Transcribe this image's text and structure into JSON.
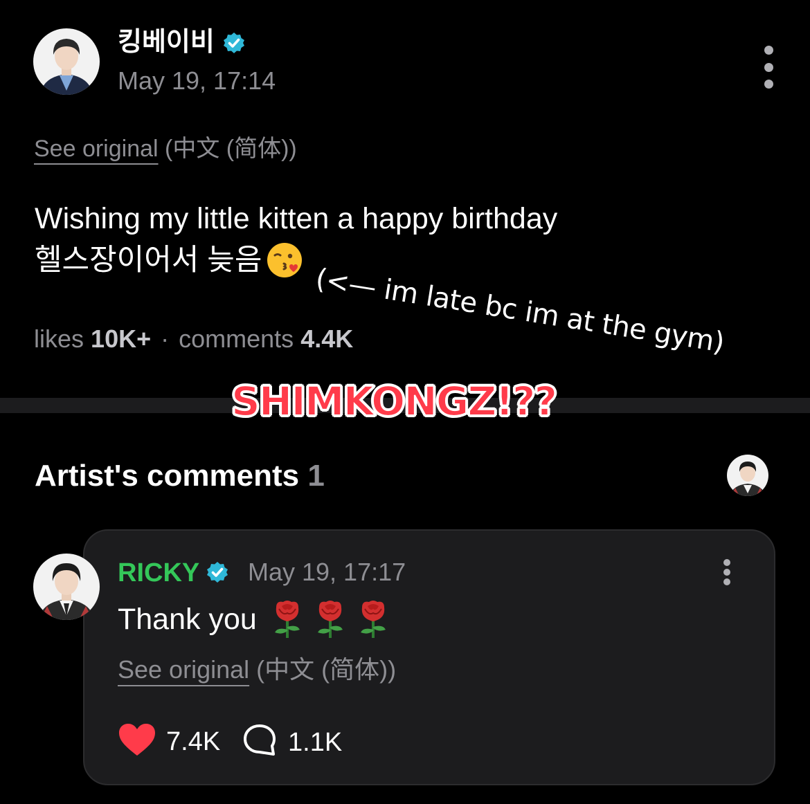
{
  "post": {
    "author": {
      "name": "킹베이비",
      "verified": true
    },
    "timestamp": "May 19, 17:14",
    "translation": {
      "link_label": "See original",
      "language": "(中文 (简体))"
    },
    "body_line1": "Wishing my little kitten a happy birthday",
    "body_line2": "헬스장이어서 늦음",
    "body_emoji_icon": "face-blowing-kiss-icon",
    "stats": {
      "likes_label": "likes",
      "likes_value": "10K+",
      "separator": "·",
      "comments_label": "comments",
      "comments_value": "4.4K"
    }
  },
  "annotations": {
    "handwritten_translation": "(<— im late bc im at the gym)",
    "caption": "SHIMKONGZ!??"
  },
  "artist_comments": {
    "title": "Artist's comments",
    "count": "1",
    "comment": {
      "author": "RICKY",
      "verified": true,
      "timestamp": "May 19, 17:17",
      "text": "Thank you",
      "rose_emojis": [
        "rose-icon",
        "rose-icon",
        "rose-icon"
      ],
      "translation": {
        "link_label": "See original",
        "language": "(中文 (简体))"
      },
      "likes": "7.4K",
      "replies": "1.1K"
    }
  },
  "colors": {
    "background": "#000000",
    "card": "#1c1c1e",
    "secondary_text": "#8e8e93",
    "verified_badge": "#2fb8d8",
    "commenter_name": "#34c759",
    "heart": "#ff3b4a",
    "caption": "#ff3b4a"
  }
}
